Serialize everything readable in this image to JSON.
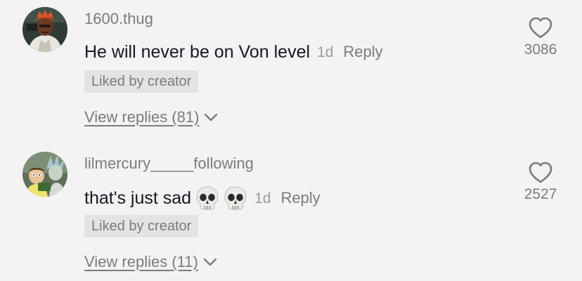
{
  "comments": [
    {
      "username": "1600.thug",
      "text": "He will never be on Von level",
      "emojis": [],
      "time": "1d",
      "reply_label": "Reply",
      "badge": "Liked by creator",
      "view_replies": "View replies (81)",
      "likes": "3086"
    },
    {
      "username": "lilmercury_____following",
      "text": "that's just sad",
      "emojis": [
        "skull-emoji",
        "skull-emoji"
      ],
      "time": "1d",
      "reply_label": "Reply",
      "badge": "Liked by creator",
      "view_replies": "View replies (11)",
      "likes": "2527"
    }
  ],
  "icons": {
    "like": "heart-outline-icon",
    "expand": "chevron-down-icon"
  },
  "colors": {
    "background": "#f3f3f3",
    "primary_text": "#161823",
    "secondary_text": "#7a7b80",
    "badge_bg": "#e3e3e4"
  }
}
